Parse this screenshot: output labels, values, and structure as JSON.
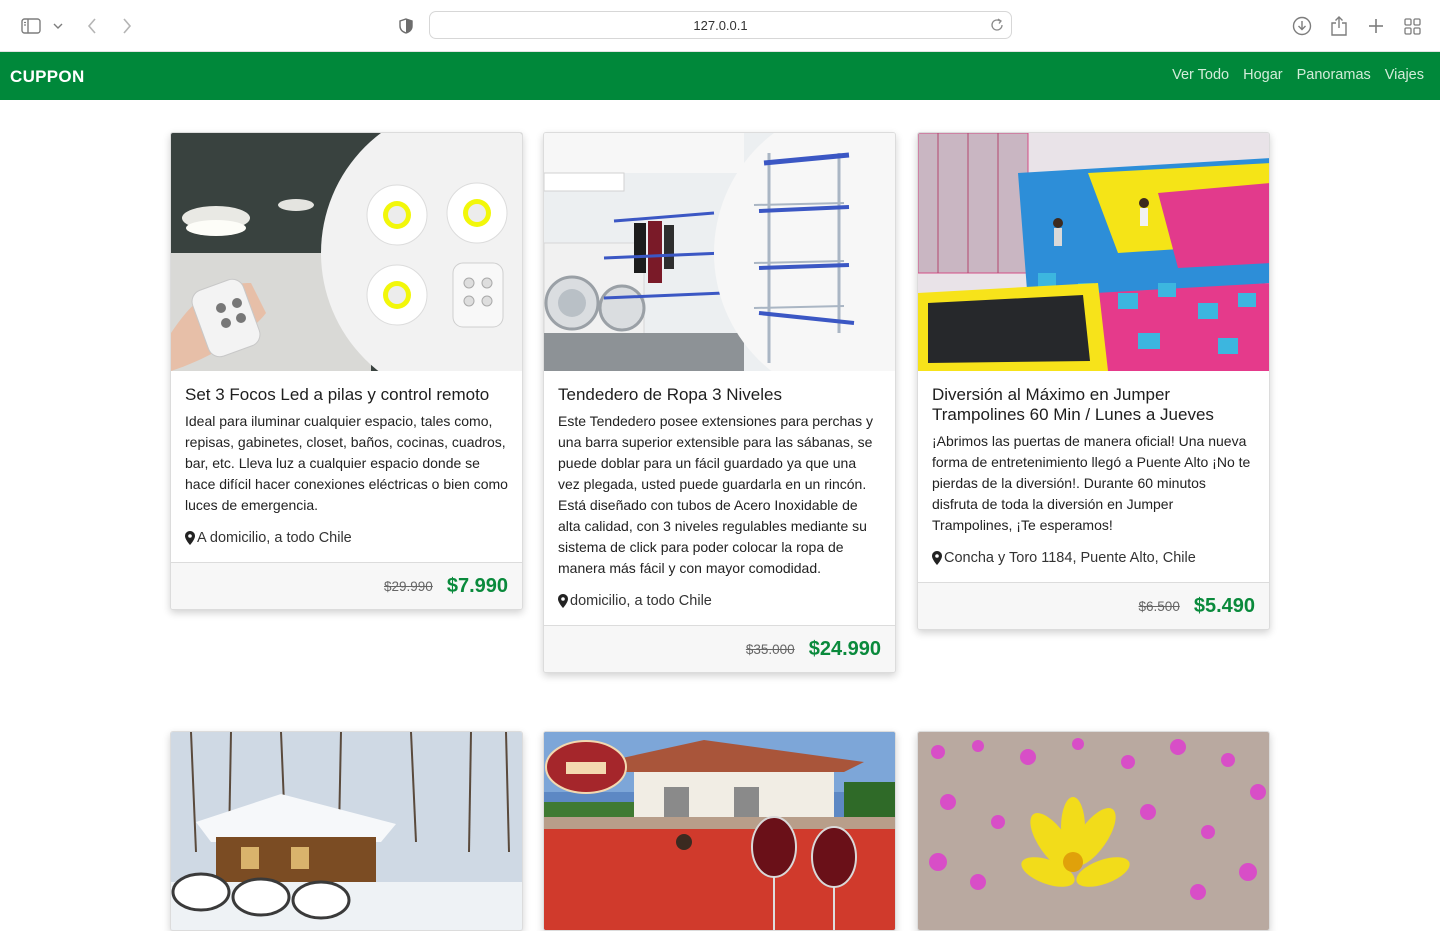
{
  "browser": {
    "url": "127.0.0.1"
  },
  "navbar": {
    "brand": "CUPPON",
    "links": [
      "Ver Todo",
      "Hogar",
      "Panoramas",
      "Viajes"
    ]
  },
  "cards": [
    {
      "title": "Set 3 Focos Led a pilas y control remoto",
      "description": "Ideal para iluminar cualquier espacio, tales como, repisas, gabinetes, closet, baños, cocinas, cuadros, bar, etc. Lleva luz a cualquier espacio donde se hace difícil hacer conexiones eléctricas o bien como luces de emergencia.",
      "location": "A domicilio, a todo Chile",
      "old_price": "$29.990",
      "price": "$7.990"
    },
    {
      "title": "Tendedero de Ropa 3 Niveles",
      "description": "Este Tendedero posee extensiones para perchas y una barra superior extensible para las sábanas, se puede doblar para un fácil guardado ya que una vez plegada, usted puede guardarla en un rincón. Está diseñado con tubos de Acero Inoxidable de alta calidad, con 3 niveles regulables mediante su sistema de click para poder colocar la ropa de manera más fácil y con mayor comodidad.",
      "location": " domicilio, a todo Chile",
      "old_price": "$35.000",
      "price": "$24.990"
    },
    {
      "title": "Diversión al Máximo en Jumper Trampolines 60 Min / Lunes a Jueves",
      "description": "¡Abrimos las puertas de manera oficial! Una nueva forma de entretenimiento llegó a Puente Alto ¡No te pierdas de la diversión!. Durante 60 minutos disfruta de toda la diversión en Jumper Trampolines, ¡Te esperamos!",
      "location": " Concha y Toro 1184, Puente Alto, Chile",
      "old_price": "$6.500",
      "price": "$5.490"
    }
  ],
  "hotel_logo": "HOTEL BOUTIQUE CASABLANCA",
  "colors": {
    "navbar": "#00883a",
    "price": "#0a8a3c"
  }
}
